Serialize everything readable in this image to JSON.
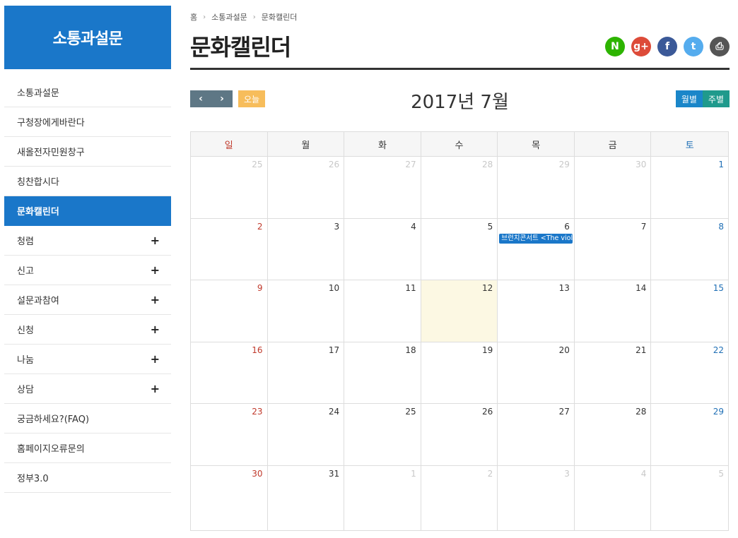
{
  "sidebar": {
    "title": "소통과설문",
    "items": [
      {
        "label": "소통과설문",
        "expandable": false,
        "active": false
      },
      {
        "label": "구청장에게바란다",
        "expandable": false,
        "active": false
      },
      {
        "label": "새올전자민원창구",
        "expandable": false,
        "active": false
      },
      {
        "label": "칭찬합시다",
        "expandable": false,
        "active": false
      },
      {
        "label": "문화캘린더",
        "expandable": false,
        "active": true
      },
      {
        "label": "청렴",
        "expandable": true,
        "active": false
      },
      {
        "label": "신고",
        "expandable": true,
        "active": false
      },
      {
        "label": "설문과참여",
        "expandable": true,
        "active": false
      },
      {
        "label": "신청",
        "expandable": true,
        "active": false
      },
      {
        "label": "나눔",
        "expandable": true,
        "active": false
      },
      {
        "label": "상담",
        "expandable": true,
        "active": false
      },
      {
        "label": "궁금하세요?(FAQ)",
        "expandable": false,
        "active": false
      },
      {
        "label": "홈페이지오류문의",
        "expandable": false,
        "active": false
      },
      {
        "label": "정부3.0",
        "expandable": false,
        "active": false
      }
    ]
  },
  "breadcrumb": [
    "홈",
    "소통과설문",
    "문화캘린더"
  ],
  "page_title": "문화캘린더",
  "share": {
    "naver": {
      "glyph": "N",
      "color": "#2db400"
    },
    "google": {
      "glyph": "g+",
      "color": "#dd4b39"
    },
    "facebook": {
      "glyph": "f",
      "color": "#3b5998"
    },
    "twitter": {
      "glyph": "t",
      "color": "#55acee"
    },
    "print": {
      "glyph": "⎙",
      "color": "#555555"
    }
  },
  "calendar": {
    "title": "2017년 7월",
    "today_label": "오늘",
    "view_month": "월별",
    "view_week": "주별",
    "weekdays": [
      "일",
      "월",
      "화",
      "수",
      "목",
      "금",
      "토"
    ],
    "weeks": [
      [
        {
          "d": "25",
          "o": true
        },
        {
          "d": "26",
          "o": true
        },
        {
          "d": "27",
          "o": true
        },
        {
          "d": "28",
          "o": true
        },
        {
          "d": "29",
          "o": true
        },
        {
          "d": "30",
          "o": true
        },
        {
          "d": "1"
        }
      ],
      [
        {
          "d": "2"
        },
        {
          "d": "3"
        },
        {
          "d": "4"
        },
        {
          "d": "5"
        },
        {
          "d": "6",
          "event": "브런치콘서트 <The viol"
        },
        {
          "d": "7"
        },
        {
          "d": "8"
        }
      ],
      [
        {
          "d": "9"
        },
        {
          "d": "10"
        },
        {
          "d": "11"
        },
        {
          "d": "12",
          "today": true
        },
        {
          "d": "13"
        },
        {
          "d": "14"
        },
        {
          "d": "15"
        }
      ],
      [
        {
          "d": "16"
        },
        {
          "d": "17"
        },
        {
          "d": "18"
        },
        {
          "d": "19"
        },
        {
          "d": "20"
        },
        {
          "d": "21"
        },
        {
          "d": "22"
        }
      ],
      [
        {
          "d": "23"
        },
        {
          "d": "24"
        },
        {
          "d": "25"
        },
        {
          "d": "26"
        },
        {
          "d": "27"
        },
        {
          "d": "28"
        },
        {
          "d": "29"
        }
      ],
      [
        {
          "d": "30"
        },
        {
          "d": "31"
        },
        {
          "d": "1",
          "o": true
        },
        {
          "d": "2",
          "o": true
        },
        {
          "d": "3",
          "o": true
        },
        {
          "d": "4",
          "o": true
        },
        {
          "d": "5",
          "o": true
        }
      ]
    ]
  },
  "colors": {
    "accent": "#1a77c9",
    "today_highlight": "#fcf8e3",
    "sunday": "#c0392b",
    "saturday": "#1f6fb5",
    "nav_button": "#5e7785",
    "today_button": "#f7bd5b"
  }
}
